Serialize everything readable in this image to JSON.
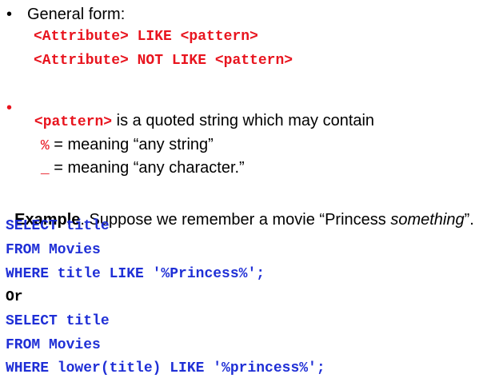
{
  "section1": {
    "bullet": "•",
    "heading": "General form:",
    "form1": "<Attribute> LIKE <pattern>",
    "form2": "<Attribute> NOT LIKE <pattern>"
  },
  "section2": {
    "bullet": "•",
    "pattern_code": "<pattern>",
    "pattern_text": " is a quoted string which may contain",
    "percent_symbol": "%",
    "percent_text": " = meaning “any string”",
    "underscore_symbol": "_",
    "underscore_text": " = meaning “any character.”"
  },
  "example": {
    "label": "Example",
    "text_before": ". Suppose we remember a movie “Princess ",
    "text_italic": "something",
    "text_after": "”.",
    "query1": [
      "SELECT title",
      "FROM Movies",
      "WHERE title LIKE '%Princess%';"
    ],
    "or": "Or",
    "query2": [
      "SELECT title",
      "FROM Movies",
      "WHERE lower(title) LIKE '%princess%';"
    ]
  },
  "colors": {
    "red": "#e8141e",
    "blue": "#1f2fd6",
    "text": "#000000"
  }
}
